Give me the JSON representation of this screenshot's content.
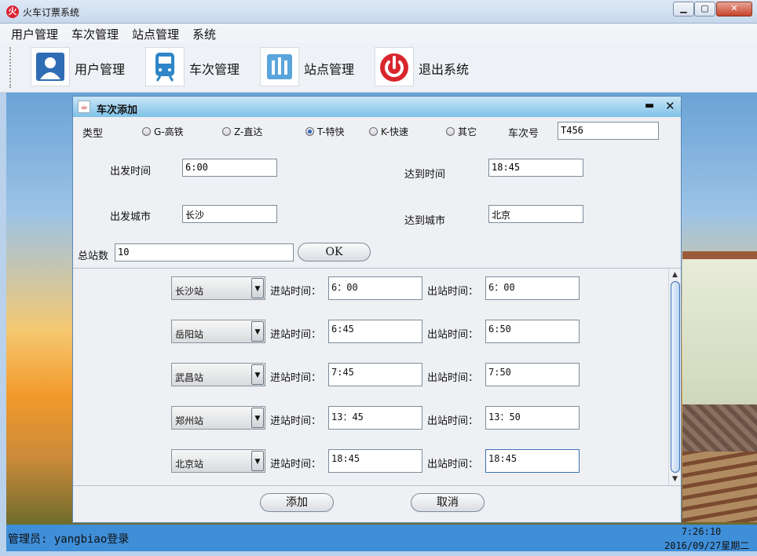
{
  "window": {
    "title": "火车订票系统",
    "icon": "railway-logo-icon",
    "controls": [
      "minimize-icon",
      "maximize-icon",
      "close-icon"
    ]
  },
  "menubar": {
    "items": [
      "用户管理",
      "车次管理",
      "站点管理",
      "系统"
    ]
  },
  "toolbar": {
    "items": [
      {
        "label": "用户管理",
        "icon": "user-icon",
        "color": "#2f6db5"
      },
      {
        "label": "车次管理",
        "icon": "train-icon",
        "color": "#2f86c8"
      },
      {
        "label": "站点管理",
        "icon": "station-icon",
        "color": "#5aa5dc"
      },
      {
        "label": "退出系统",
        "icon": "power-icon",
        "color": "#d9262c"
      }
    ]
  },
  "dialog": {
    "title": "车次添加",
    "type_label": "类型",
    "types": [
      {
        "label": "G-高铁",
        "selected": false
      },
      {
        "label": "Z-直达",
        "selected": false
      },
      {
        "label": "T-特快",
        "selected": true
      },
      {
        "label": "K-快速",
        "selected": false
      },
      {
        "label": "其它",
        "selected": false
      }
    ],
    "train_no_label": "车次号",
    "train_no": "T456",
    "depart_time_label": "出发时间",
    "depart_time": "6:00",
    "arrive_time_label": "达到时间",
    "arrive_time": "18:45",
    "depart_city_label": "出发城市",
    "depart_city": "长沙",
    "arrive_city_label": "达到城市",
    "arrive_city": "北京",
    "total_stations_label": "总站数",
    "total_stations": "10",
    "ok_label": "OK",
    "enter_label": "进站时间：",
    "exit_label": "出站时间：",
    "stations": [
      {
        "name": "长沙站",
        "enter": "6：00",
        "exit": "6：00"
      },
      {
        "name": "岳阳站",
        "enter": "6:45",
        "exit": "6:50"
      },
      {
        "name": "武昌站",
        "enter": "7:45",
        "exit": "7:50"
      },
      {
        "name": "郑州站",
        "enter": "13：45",
        "exit": "13：50"
      },
      {
        "name": "北京站",
        "enter": "18:45",
        "exit": "18:45"
      }
    ],
    "add_label": "添加",
    "cancel_label": "取消"
  },
  "status": {
    "admin_text": "管理员: yangbiao登录",
    "time": "7:26:10",
    "date": "2016/09/27星期二"
  }
}
